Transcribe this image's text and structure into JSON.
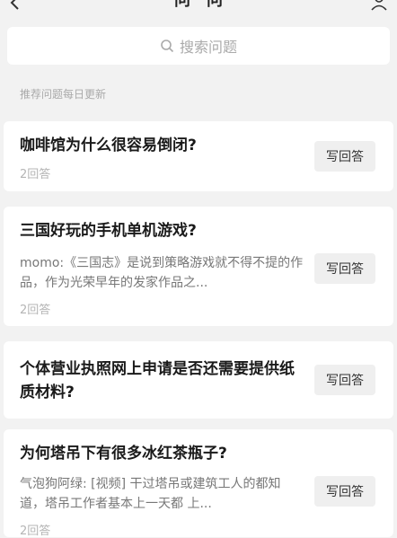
{
  "nav": {
    "title": "问一问",
    "back_icon": "chevron-left-icon",
    "user_icon": "user-icon"
  },
  "search": {
    "placeholder": "搜索问题",
    "icon": "search-icon"
  },
  "section": {
    "label": "推荐问题每日更新"
  },
  "questions": [
    {
      "title": "咖啡馆为什么很容易倒闭?",
      "excerpt": "",
      "meta": "2回答",
      "button": "写回答"
    },
    {
      "title": "三国好玩的手机单机游戏?",
      "excerpt": "momo:《三国志》是说到策略游戏就不得不提的作品，作为光荣早年的发家作品之...",
      "meta": "2回答",
      "button": "写回答"
    },
    {
      "title": "个体营业执照网上申请是否还需要提供纸质材料?",
      "excerpt": "",
      "meta": "",
      "button": "写回答"
    },
    {
      "title": "为何塔吊下有很多冰红茶瓶子?",
      "excerpt": "气泡狗阿绿: [视频] 干过塔吊或建筑工人的都知道，塔吊工作者基本上一天都 上...",
      "meta": "2回答",
      "button": "写回答"
    }
  ]
}
